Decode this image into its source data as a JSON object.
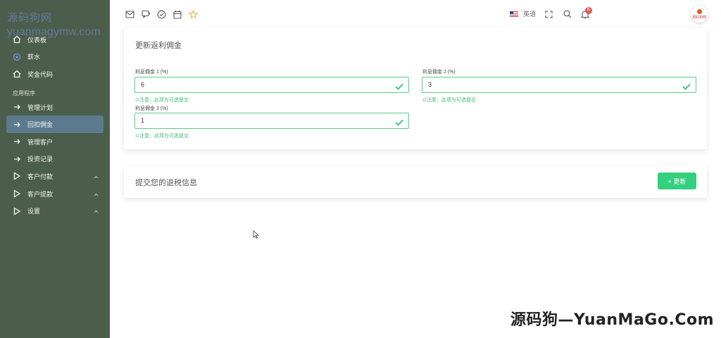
{
  "brand": {
    "name_cn": "源码狗网",
    "name_en": "yuanmagymw.com"
  },
  "sidebar": {
    "top_items": [
      {
        "label": "仪表板",
        "icon": "home-icon"
      },
      {
        "label": "薪水",
        "icon": "target-icon"
      },
      {
        "label": "奖金代码",
        "icon": "home-icon"
      }
    ],
    "section_title": "应用程序",
    "app_items": [
      {
        "label": "管理计划",
        "icon": "arrow-right-icon"
      },
      {
        "label": "回扣佣金",
        "icon": "arrow-right-icon",
        "active": true
      },
      {
        "label": "管理客户",
        "icon": "arrow-right-icon"
      },
      {
        "label": "投资记录",
        "icon": "arrow-right-icon"
      },
      {
        "label": "客户付款",
        "icon": "play-icon",
        "expandable": true
      },
      {
        "label": "客户提款",
        "icon": "play-icon",
        "expandable": true
      },
      {
        "label": "设置",
        "icon": "play-icon",
        "expandable": true
      }
    ]
  },
  "topbar": {
    "icons": [
      "mail-icon",
      "chat-icon",
      "check-circle-icon",
      "calendar-icon",
      "star-icon"
    ],
    "language": "英语",
    "notification_count": "5",
    "avatar_text": "源码狗网"
  },
  "rebate_form": {
    "title": "更新返利佣金",
    "fields": [
      {
        "label": "利息佣金 1 (%)",
        "value": "6",
        "note": "⊙注意：此项为可选提交"
      },
      {
        "label": "利息佣金 2 (%)",
        "value": "3",
        "note": "⊙注意：此项为可选提交"
      },
      {
        "label": "利息佣金 3 (%)",
        "value": "1",
        "note": "⊙注意：此项为可选提交"
      }
    ]
  },
  "submit_card": {
    "title": "提交您的退税信息",
    "button_label": "+ 更新"
  },
  "watermark": "源码狗—YuanMaGo.Com",
  "colors": {
    "sidebar_bg": "#4b5e4b",
    "active_item": "#5c7a8e",
    "success_green": "#34d07e",
    "field_border": "#5ccc8a",
    "badge_red": "#e05555"
  }
}
